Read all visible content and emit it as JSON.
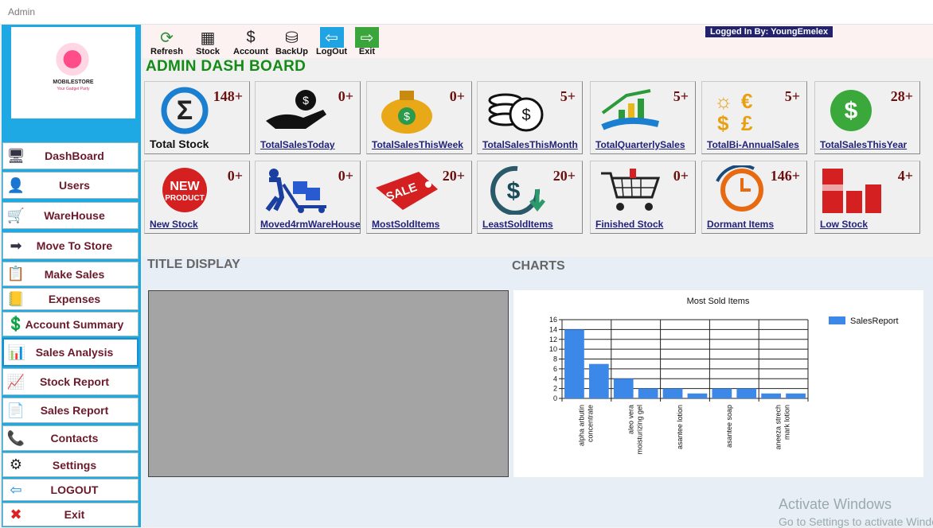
{
  "window": {
    "title": "Admin"
  },
  "logo": {
    "name": "MOBILESTORE",
    "tagline": "Your Gadget Party"
  },
  "sidebar": {
    "items": [
      {
        "label": "DashBoard",
        "icon": "computer-icon"
      },
      {
        "label": "Users",
        "icon": "user-icon"
      },
      {
        "label": "WareHouse",
        "icon": "hand-truck-icon"
      },
      {
        "label": "Move To Store",
        "icon": "move-arrow-icon"
      },
      {
        "label": "Make Sales",
        "icon": "clipboard-icon"
      },
      {
        "label": "Expenses",
        "icon": "ledger-icon"
      },
      {
        "label": "Account Summary",
        "icon": "coin-icon"
      },
      {
        "label": "Sales Analysis",
        "icon": "analysis-chart-icon"
      },
      {
        "label": "Stock Report",
        "icon": "report-icon"
      },
      {
        "label": "Sales Report",
        "icon": "document-icon"
      },
      {
        "label": "Contacts",
        "icon": "phone-icon"
      },
      {
        "label": "Settings",
        "icon": "gear-icon"
      },
      {
        "label": "LOGOUT",
        "icon": "logout-icon"
      },
      {
        "label": "Exit",
        "icon": "close-icon"
      }
    ],
    "active": "Sales Analysis"
  },
  "toolbar": {
    "items": [
      {
        "label": "Refresh",
        "icon": "refresh-icon"
      },
      {
        "label": "Stock",
        "icon": "stock-icon"
      },
      {
        "label": "Account",
        "icon": "account-icon"
      },
      {
        "label": "BackUp",
        "icon": "backup-icon"
      },
      {
        "label": "LogOut",
        "icon": "logout-icon"
      },
      {
        "label": "Exit",
        "icon": "exit-icon"
      }
    ],
    "logged_in": "Logged In By:  YoungEmelex"
  },
  "dashboard": {
    "title": "ADMIN DASH BOARD",
    "cards": [
      {
        "label": "Total Stock",
        "count": "148+",
        "icon": "sigma-icon",
        "plain": true
      },
      {
        "label": "TotalSalesToday",
        "count": "0+",
        "icon": "money-bag-hand-icon"
      },
      {
        "label": "TotalSalesThisWeek",
        "count": "0+",
        "icon": "dollar-bag-icon"
      },
      {
        "label": "TotalSalesThisMonth",
        "count": "5+",
        "icon": "coins-stack-icon"
      },
      {
        "label": "TotalQuarterlySales",
        "count": "5+",
        "icon": "growth-hand-icon"
      },
      {
        "label": "TotalBi-AnnualSales",
        "count": "5+",
        "icon": "currency-symbols-icon"
      },
      {
        "label": "TotalSalesThisYear",
        "count": "28+",
        "icon": "dollar-circle-icon"
      },
      {
        "label": "New Stock",
        "count": "0+",
        "icon": "new-product-badge-icon"
      },
      {
        "label": "Moved4rmWareHouse",
        "count": "0+",
        "icon": "trolley-mover-icon"
      },
      {
        "label": "MostSoldItems",
        "count": "20+",
        "icon": "sale-tag-icon"
      },
      {
        "label": "LeastSoldItems",
        "count": "20+",
        "icon": "dollar-down-icon"
      },
      {
        "label": "Finished Stock",
        "count": "0+",
        "icon": "shopping-cart-icon"
      },
      {
        "label": "Dormant Items",
        "count": "146+",
        "icon": "clock-cycle-icon"
      },
      {
        "label": "Low Stock",
        "count": "4+",
        "icon": "low-bars-icon"
      }
    ]
  },
  "sections": {
    "title_display": "TITLE DISPLAY",
    "charts": "CHARTS"
  },
  "chart_data": {
    "type": "bar",
    "title": "Most Sold Items",
    "legend": "SalesReport",
    "legend_position": "right",
    "ylim": [
      0,
      16
    ],
    "yticks": [
      0,
      2,
      4,
      6,
      8,
      10,
      12,
      14,
      16
    ],
    "grid": true,
    "categories": [
      "alpha arbutin concentrate",
      "",
      "aleo vera moisturizing gel",
      "",
      "asantee lotion",
      "",
      "asantee soap",
      "",
      "aneeza strech mark lotion",
      ""
    ],
    "series": [
      {
        "name": "SalesReport",
        "values": [
          14,
          7,
          4,
          2,
          2,
          1,
          2,
          2,
          1,
          1
        ],
        "color": "#3b88e8"
      }
    ]
  },
  "watermark": {
    "line1": "Activate Windows",
    "line2": "Go to Settings to activate Windows."
  }
}
